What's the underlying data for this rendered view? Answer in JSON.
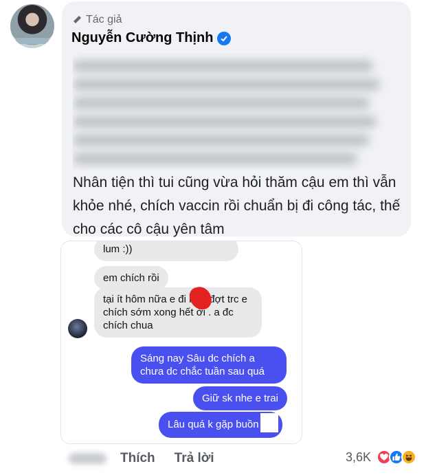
{
  "comment": {
    "author_tag": "Tác giả",
    "author_name": "Nguyễn Cường Thịnh",
    "text": "Nhân tiện thì tui cũng vừa hỏi thăm cậu em thì vẫn khỏe nhé, chích vaccin rồi chuẩn bị đi công tác, thế cho các cô cậu yên tâm"
  },
  "chat": {
    "messages": [
      {
        "side": "received",
        "text": "lum :))"
      },
      {
        "side": "received",
        "text": "em chích rồi"
      },
      {
        "side": "received",
        "text": "tại ít hôm nữa e đi       nên đợt trc e chích sớm xong hết ời . a đc chích chua"
      },
      {
        "side": "sent",
        "text": "Sáng nay Sâu dc chích a chưa dc chắc tuần sau quá"
      },
      {
        "side": "sent",
        "text": "Giữ sk nhe e trai"
      },
      {
        "side": "sent",
        "text": "Lâu quá k gặp buồn"
      }
    ]
  },
  "actions": {
    "like_label": "Thích",
    "reply_label": "Trả lời"
  },
  "reactions": {
    "count": "3,6K",
    "icons": [
      "love-icon",
      "like-icon",
      "haha-icon"
    ],
    "colors": {
      "love": "#f33e58",
      "like": "#1877f2",
      "haha": "#f7b125"
    }
  },
  "colors": {
    "bubble_bg": "#f0f2f5",
    "sent_bubble": "#4a4ff0",
    "verified": "#1877f2"
  }
}
